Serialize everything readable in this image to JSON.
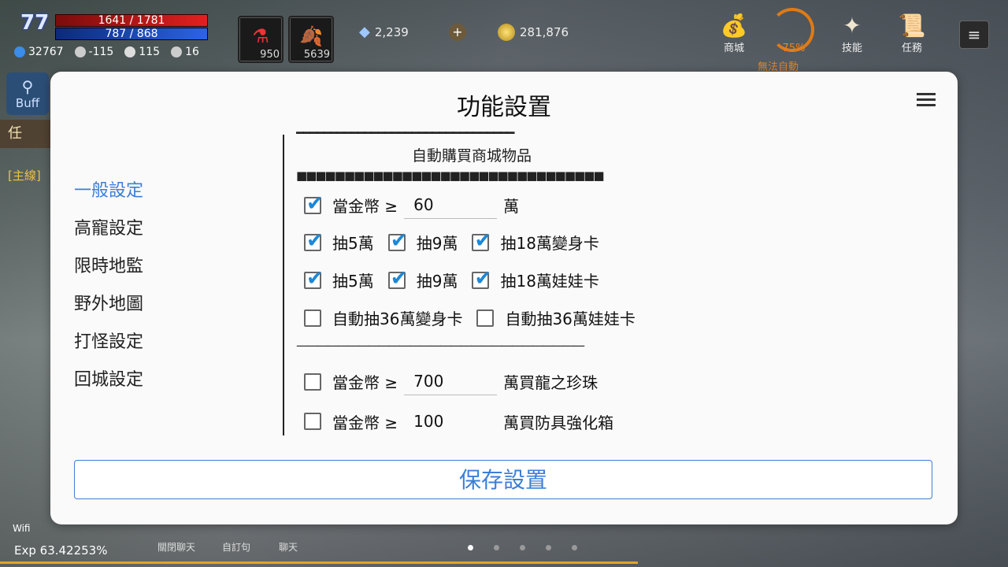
{
  "hud": {
    "level": "77",
    "hp": "1641 / 1781",
    "mp": "787 / 868",
    "stats": [
      "32767",
      "-115",
      "115",
      "16"
    ],
    "slots": [
      {
        "glyph": "⚗",
        "count": "950"
      },
      {
        "glyph": "🍂",
        "count": "5639"
      }
    ],
    "diamonds": "2,239",
    "gold": "281,876",
    "top_icons": [
      {
        "glyph": "💰",
        "label": "商城"
      },
      {
        "glyph": "✦",
        "label": "技能"
      },
      {
        "glyph": "📜",
        "label": "任務"
      }
    ],
    "auto_percent": "75%",
    "auto_status": "無法自動",
    "buff_label": "Buff",
    "quest_tab": "任",
    "main_quest": "[主線]",
    "wifi": "Wifi",
    "exp": "Exp 63.42253%",
    "bottom_buttons": [
      "關閉聊天",
      "自訂句",
      "聊天"
    ]
  },
  "dialog": {
    "title": "功能設置",
    "nav": [
      "一般設定",
      "高寵設定",
      "限時地監",
      "野外地圖",
      "打怪設定",
      "回城設定"
    ],
    "dash_top": "━━━━━━━━━━━━━━━━━━━━━━━━━━━━━━━━",
    "section_title": "自動購買商城物品",
    "dash_bottom": "■■■■■■■■■■■■■■■■■■■■■■■■■■■■■■■■",
    "row1": {
      "prefix": "當金幣 ≥",
      "value": "60",
      "suffix": "萬"
    },
    "row2": [
      "抽5萬",
      "抽9萬",
      "抽18萬變身卡"
    ],
    "row3": [
      "抽5萬",
      "抽9萬",
      "抽18萬娃娃卡"
    ],
    "row4": [
      "自動抽36萬變身卡",
      "自動抽36萬娃娃卡"
    ],
    "separator": "————————————————————————————",
    "row5": {
      "prefix": "當金幣 ≥",
      "value": "700",
      "suffix": "萬買龍之珍珠"
    },
    "row6": {
      "prefix": "當金幣 ≥",
      "value": "100",
      "suffix": "萬買防具強化箱"
    },
    "save": "保存設置"
  },
  "colors": {
    "accent": "#3b7fd8",
    "check": "#1e88d6"
  }
}
